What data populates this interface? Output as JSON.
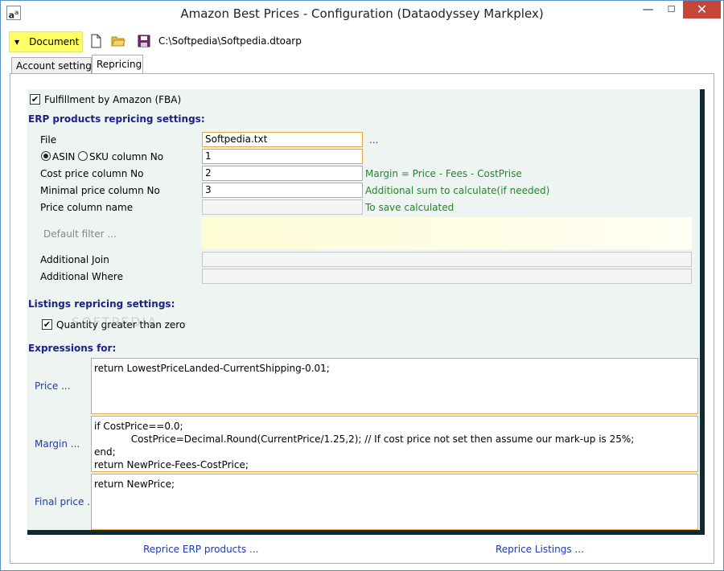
{
  "window": {
    "title": "Amazon Best Prices - Configuration (Dataodyssey Markplex)",
    "minimize": "—",
    "maximize": "☐",
    "close": "✕"
  },
  "toolbar": {
    "document_label": "Document",
    "file_path": "C:\\Softpedia\\Softpedia.dtoarp"
  },
  "tabs": [
    {
      "label": "Account settings",
      "active": false
    },
    {
      "label": "Repricing",
      "active": true
    }
  ],
  "fba": {
    "label": "Fulfillment by Amazon (FBA)",
    "checked": true
  },
  "erp": {
    "title": "ERP products repricing settings:",
    "file_label": "File",
    "file_value": "Softpedia.txt",
    "browse_link": "...",
    "asin_label": "ASIN",
    "sku_label": "SKU column No",
    "sku_value": "1",
    "cost_label": "Cost price column No",
    "cost_value": "2",
    "cost_note": "Margin = Price - Fees - CostPrise",
    "minimal_label": "Minimal price column No",
    "minimal_value": "3",
    "minimal_note": "Additional sum to calculate(if needed)",
    "price_col_label": "Price column name",
    "price_col_value": "",
    "price_col_note": "To save calculated",
    "filter_button": "Default filter ...",
    "join_label": "Additional Join",
    "join_value": "",
    "where_label": "Additional Where",
    "where_value": ""
  },
  "listings": {
    "title": "Listings repricing settings:",
    "qty_label": "Quantity greater than zero",
    "qty_checked": true
  },
  "expressions": {
    "title": "Expressions for:",
    "price_link": "Price ...",
    "price_code": "return LowestPriceLanded-CurrentShipping-0.01;",
    "margin_link": "Margin ...",
    "margin_code": "if CostPrice==0.0;\n            CostPrice=Decimal.Round(CurrentPrice/1.25,2); // If cost price not set then assume our mark-up is 25%;\nend;\nreturn NewPrice-Fees-CostPrice;",
    "final_link": "Final price ...",
    "final_code": "return NewPrice;"
  },
  "footer": {
    "reprice_erp": "Reprice ERP products ...",
    "reprice_listings": "Reprice Listings ..."
  },
  "watermark": "SOFTPEDIA"
}
